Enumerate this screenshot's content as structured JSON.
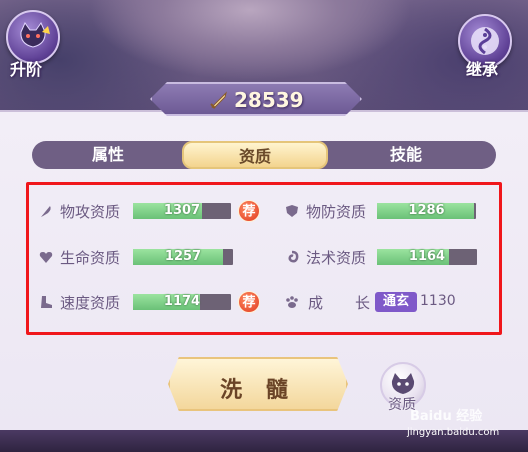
{
  "top": {
    "upgrade_label": "升阶",
    "inherit_label": "继承"
  },
  "power": {
    "value": "28539",
    "icon": "sword-icon"
  },
  "tabs": [
    {
      "label": "属性",
      "active": false
    },
    {
      "label": "资质",
      "active": true
    },
    {
      "label": "技能",
      "active": false
    }
  ],
  "stats": {
    "phys_atk": {
      "label": "物攻资质",
      "value": "1307",
      "fill": 0.7,
      "icon": "feather-icon",
      "badge": "荐"
    },
    "phys_def": {
      "label": "物防资质",
      "value": "1286",
      "fill": 0.98,
      "icon": "shield-icon"
    },
    "hp": {
      "label": "生命资质",
      "value": "1257",
      "fill": 0.9,
      "icon": "heart-icon"
    },
    "magic": {
      "label": "法术资质",
      "value": "1164",
      "fill": 0.72,
      "icon": "swirl-icon"
    },
    "speed": {
      "label": "速度资质",
      "value": "1174",
      "fill": 0.68,
      "icon": "boot-icon",
      "badge": "荐"
    },
    "growth": {
      "label_a": "成",
      "label_b": "长",
      "tier": "通玄",
      "value": "1130",
      "icon": "paw-icon"
    }
  },
  "actions": {
    "wash_label": "洗 髓",
    "zizhi_label": "资质"
  },
  "watermark": {
    "brand": "Baidu 经验",
    "url": "jingyan.baidu.com"
  },
  "colors": {
    "frame": "#f0161b",
    "bar_fill": "#7fd38a",
    "tab_active": "#f3d48e"
  }
}
